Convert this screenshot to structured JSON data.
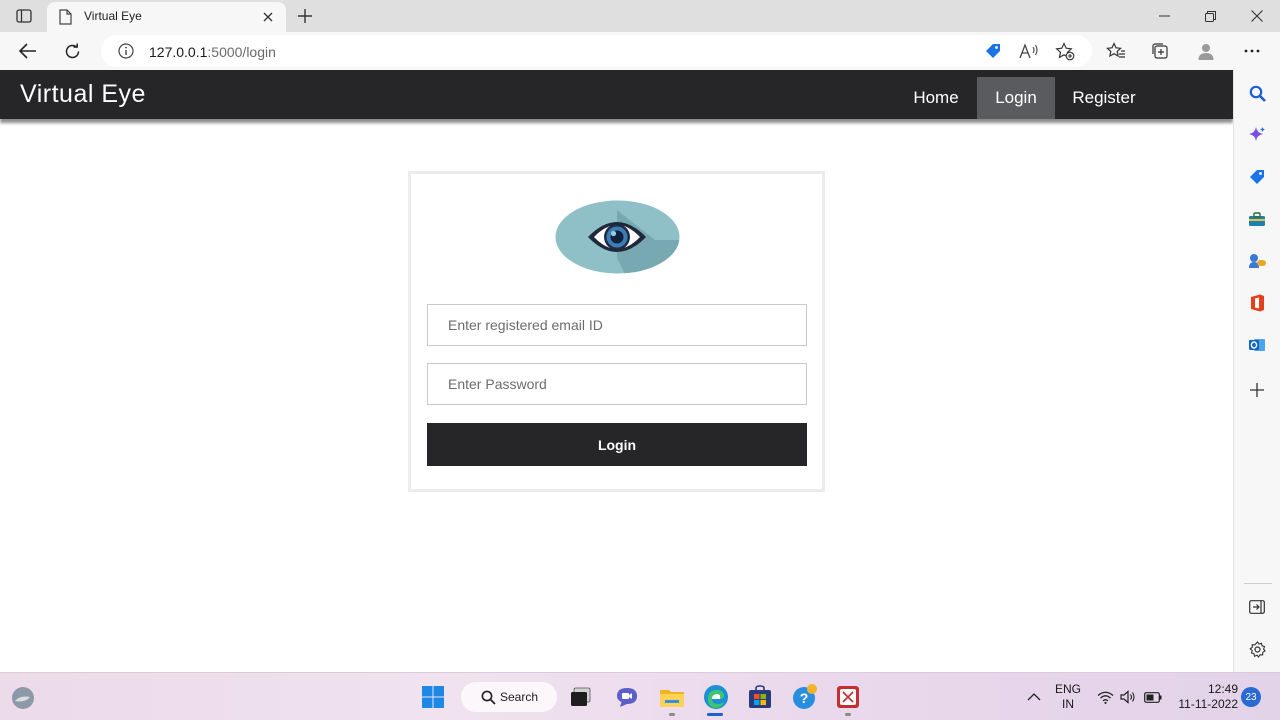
{
  "browser": {
    "tab_title": "Virtual Eye",
    "url_host": "127.0.0.1",
    "url_path": ":5000/login"
  },
  "site": {
    "brand": "Virtual Eye",
    "nav": [
      {
        "label": "Home",
        "active": false
      },
      {
        "label": "Login",
        "active": true
      },
      {
        "label": "Register",
        "active": false
      }
    ]
  },
  "login_form": {
    "email_placeholder": "Enter registered email ID",
    "password_placeholder": "Enter Password",
    "submit_label": "Login"
  },
  "taskbar": {
    "search_label": "Search",
    "language": "ENG",
    "region": "IN",
    "time": "12:49",
    "date": "11-11-2022",
    "notification_count": "23"
  },
  "colors": {
    "navbar": "#262628",
    "nav_active": "#5a5b5e",
    "login_button": "#262628",
    "eye_disc": "#8fbfc7"
  },
  "icons": [
    "tab-actions-icon",
    "page-icon",
    "close-icon",
    "plus-icon",
    "minimize-icon",
    "restore-icon",
    "back-icon",
    "refresh-icon",
    "info-icon",
    "coupon-icon",
    "read-aloud-icon",
    "add-favorite-icon",
    "favorites-icon",
    "collections-icon",
    "profile-icon",
    "more-icon",
    "search-icon",
    "copilot-icon",
    "shopping-icon",
    "tools-icon",
    "games-icon",
    "office-icon",
    "outlook-icon",
    "add-icon",
    "sidebar-toggle-icon",
    "settings-icon",
    "eye-icon",
    "windows-start-icon",
    "task-view-icon",
    "chat-icon",
    "file-explorer-icon",
    "edge-icon",
    "store-icon",
    "help-icon",
    "app-icon",
    "chevron-up-icon",
    "wifi-icon",
    "volume-icon",
    "battery-icon"
  ]
}
